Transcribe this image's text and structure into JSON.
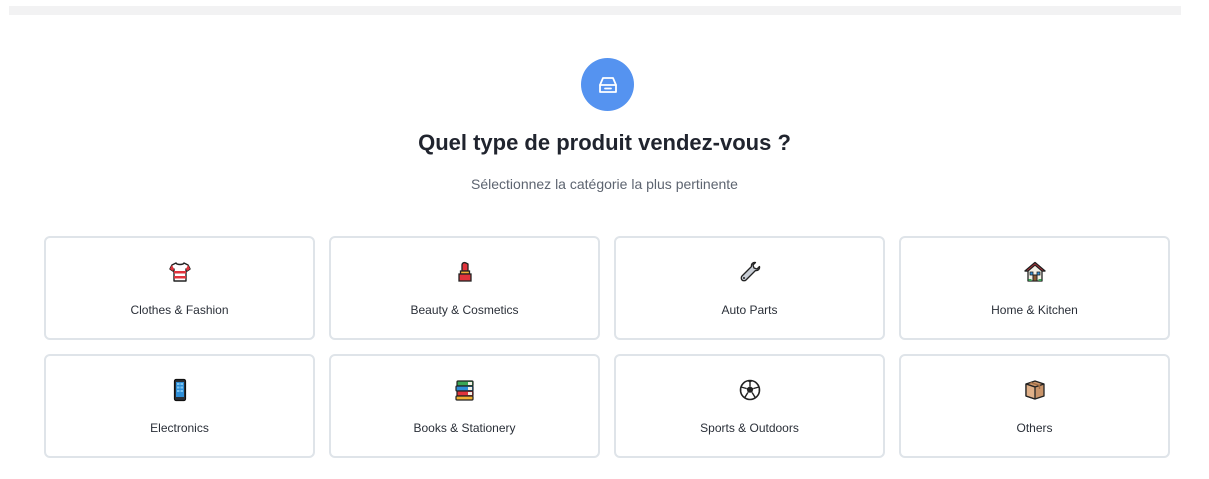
{
  "header": {
    "icon": "archive-box-icon",
    "accent_color": "#5593f0",
    "title": "Quel type de produit vendez-vous ?",
    "subtitle": "Sélectionnez la catégorie la plus pertinente"
  },
  "categories": [
    {
      "label": "Clothes & Fashion",
      "icon": "shirt-icon"
    },
    {
      "label": "Beauty & Cosmetics",
      "icon": "lipstick-icon"
    },
    {
      "label": "Auto Parts",
      "icon": "wrench-icon"
    },
    {
      "label": "Home & Kitchen",
      "icon": "house-icon"
    },
    {
      "label": "Electronics",
      "icon": "mobile-phone-icon"
    },
    {
      "label": "Books & Stationery",
      "icon": "books-icon"
    },
    {
      "label": "Sports & Outdoors",
      "icon": "soccer-ball-icon"
    },
    {
      "label": "Others",
      "icon": "package-icon"
    }
  ]
}
